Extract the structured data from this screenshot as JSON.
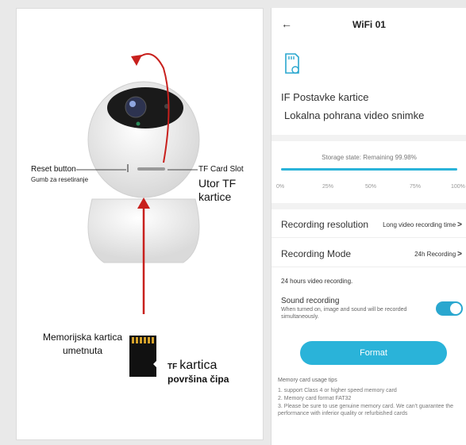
{
  "illustration": {
    "reset_button": "Reset button",
    "reset_button_hr": "Gumb za resetiranje",
    "tf_card_slot": "TF Card Slot",
    "tf_slot_hr": "Utor TF kartice",
    "memory_card_inserted": "Memorijska kartica umetnuta",
    "tf_prefix": "TF",
    "card_word": "kartica",
    "chip_surface": "površina čipa"
  },
  "app": {
    "back_icon": "←",
    "title": "WiFi 01",
    "settings_title": "IF Postavke kartice",
    "settings_subtitle": "Lokalna pohrana video snimke",
    "storage_state": "Storage state: Remaining 99.98%",
    "storage_remaining_fraction": 0.9998,
    "ticks": [
      "0%",
      "25%",
      "50%",
      "75%",
      "100%"
    ],
    "resolution_label": "Recording resolution",
    "resolution_value": "Long video recording time",
    "mode_label": "Recording Mode",
    "mode_value": "24h Recording",
    "hours_recording": "24 hours video recording.",
    "sound_title": "Sound recording",
    "sound_desc": "When turned on, image and sound will be recorded simultaneously.",
    "sound_on": true,
    "format_button": "Format",
    "tips_title": "Memory card usage tips",
    "tips": [
      "1. support Class 4 or higher speed memory card",
      "2. Memory card format FAT32",
      "3. Please be sure to use genuine memory card. We can't guarantee the performance with inferior quality or refurbished cards"
    ],
    "accent_color": "#2ab3d9"
  }
}
